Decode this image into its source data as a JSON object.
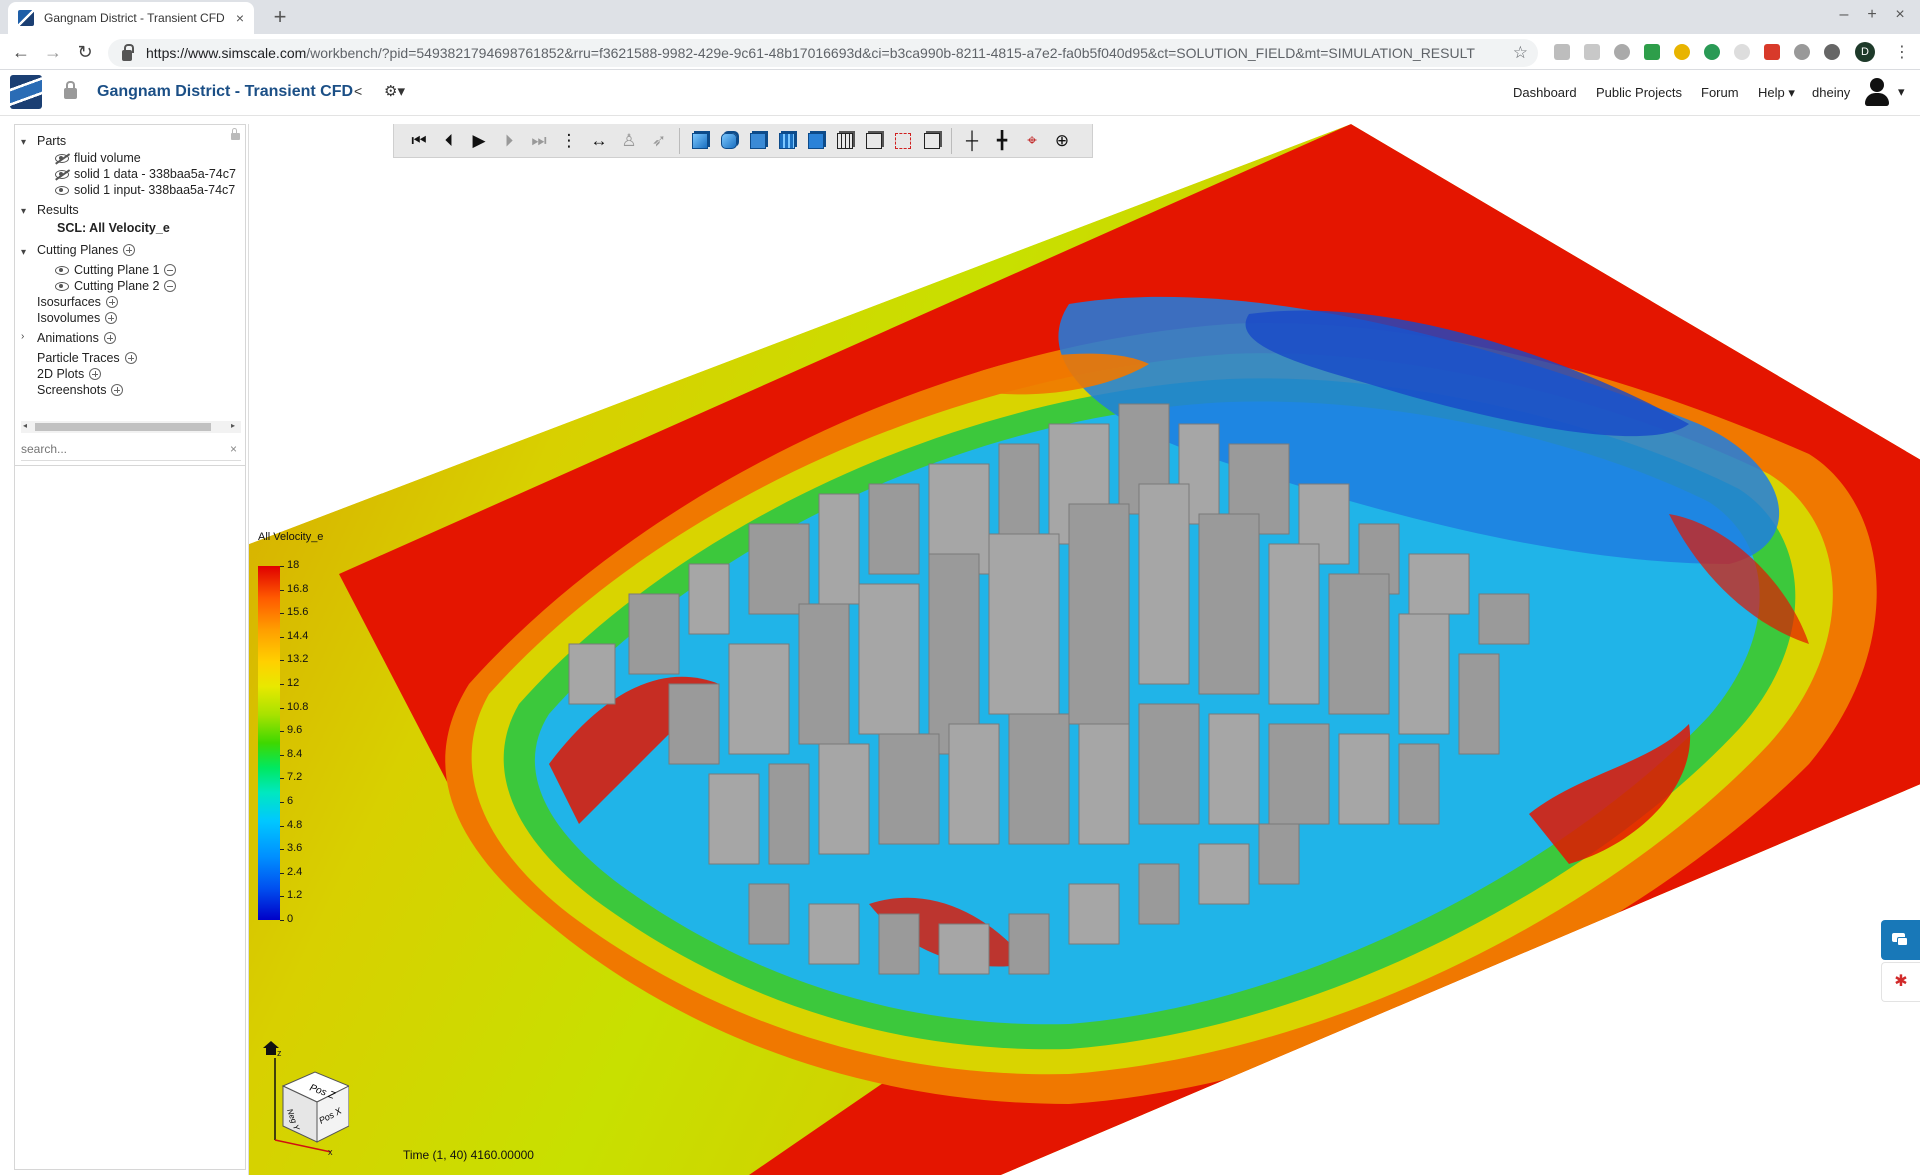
{
  "browser": {
    "tab_title": "Gangnam District - Transient CFD",
    "tab_close": "×",
    "new_tab": "+",
    "url_host": "https://www.simscale.com",
    "url_path": "/workbench/?pid=5493821794698761852&rru=f3621588-9982-429e-9c61-48b17016693d&ci=b3ca990b-8211-4815-a7e2-fa0b5f040d95&ct=SOLUTION_FIELD&mt=SIMULATION_RESULT",
    "profile_initial": "D",
    "window_controls": [
      "–",
      "+",
      "×"
    ]
  },
  "header": {
    "project_title": "Gangnam District - Transient CFD",
    "nav": [
      "Dashboard",
      "Public Projects",
      "Forum",
      "Help"
    ],
    "username": "dheiny"
  },
  "tree": {
    "parts_label": "Parts",
    "parts": [
      "fluid volume",
      "solid 1 data - 338baa5a-74c7",
      "solid 1 input- 338baa5a-74c7"
    ],
    "results_label": "Results",
    "result_item": "SCL: All Velocity_e",
    "cutting_planes_label": "Cutting Planes",
    "cutting_planes": [
      "Cutting Plane 1",
      "Cutting Plane 2"
    ],
    "isosurfaces": "Isosurfaces",
    "isovolumes": "Isovolumes",
    "animations": "Animations",
    "particle_traces": "Particle Traces",
    "plots_2d": "2D Plots",
    "screenshots": "Screenshots",
    "search_placeholder": "search...",
    "search_clear": "×"
  },
  "viewer": {
    "toolbar_icons": [
      "skip-to-start",
      "step-back",
      "play",
      "step-forward",
      "skip-to-end",
      "more-vertical",
      "fit-view",
      "walk-mode",
      "fly-mode",
      "solid-view",
      "smooth-view",
      "surface-view",
      "surface-mesh-view",
      "surface-edges-view",
      "wireframe-view",
      "outline-view",
      "hidden-line-view",
      "cutting-plane-p",
      "cutting-plane-e",
      "pick-point",
      "center-rotation"
    ],
    "legend_title": "All Velocity_e",
    "legend_ticks": [
      "18",
      "16.8",
      "15.6",
      "14.4",
      "13.2",
      "12",
      "10.8",
      "9.6",
      "8.4",
      "7.2",
      "6",
      "4.8",
      "3.6",
      "2.4",
      "1.2",
      "0"
    ],
    "legend_colors": [
      "#e00000",
      "#ff9e00",
      "#e8e800",
      "#3ed800",
      "#00e8c0",
      "#0090ff",
      "#0000c8"
    ],
    "time_readout": "Time (1, 40) 4160.00000",
    "orientation_cube": {
      "top": "Pos Z",
      "left": "Neg Y",
      "right": "Pos X"
    },
    "axis_z": "z",
    "axis_x": "x"
  }
}
